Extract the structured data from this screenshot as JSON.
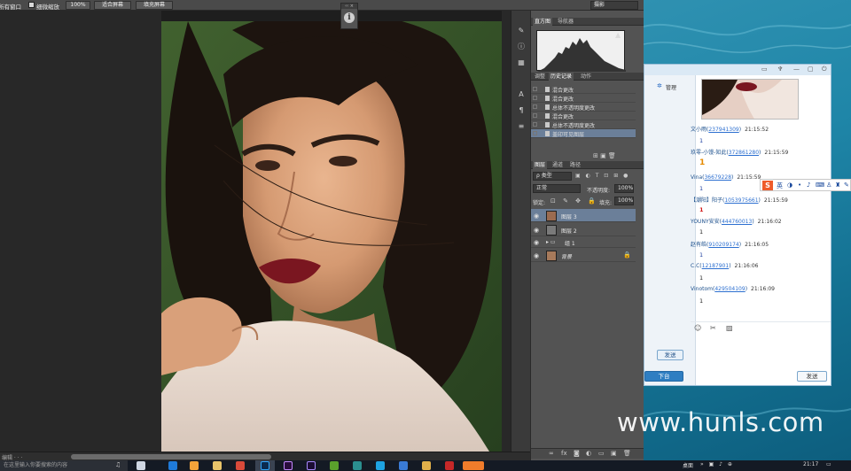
{
  "options_bar": {
    "all_windows_label": "所有窗口",
    "scrubby_zoom_label": "细微缩放",
    "zoom_100_label": "100%",
    "fit_screen_label": "适合屏幕",
    "fill_screen_label": "填充屏幕",
    "workspace_select": "摄影"
  },
  "status_bar": {
    "text": "编辑 · · ·"
  },
  "panels": {
    "top_tabs": [
      "直方图",
      "导航器"
    ],
    "history_tabs": [
      "调整",
      "历史记录",
      "动作"
    ],
    "history_items": [
      {
        "label": "混合更改",
        "selected": false
      },
      {
        "label": "混合更改",
        "selected": false
      },
      {
        "label": "总体不透明度更改",
        "selected": false
      },
      {
        "label": "混合更改",
        "selected": false
      },
      {
        "label": "总体不透明度更改",
        "selected": false
      },
      {
        "label": "盖印可见图层",
        "selected": true
      }
    ],
    "layers_tabs": [
      "图层",
      "通道",
      "路径"
    ],
    "kind_filter": "ρ 类型",
    "blend_mode": "正常",
    "opacity_label": "不透明度:",
    "opacity_value": "100%",
    "lock_label": "锁定:",
    "fill_label": "填充:",
    "fill_value": "100%",
    "layers": [
      {
        "name": "图层 3",
        "selected": true
      },
      {
        "name": "图层 2",
        "selected": false
      },
      {
        "name": "组 1",
        "selected": false
      },
      {
        "name": "背景",
        "selected": false
      }
    ]
  },
  "qq": {
    "manage_label": "管理",
    "messages": [
      {
        "nick": "文小雨",
        "qq": "237941309",
        "time": "21:15:52",
        "body": "1",
        "style": "normal"
      },
      {
        "nick": "玖零-小馒-知此",
        "qq": "372861280",
        "time": "21:15:59",
        "body": "1",
        "style": "big"
      },
      {
        "nick": "Vina",
        "qq": "36679228",
        "time": "21:15:59",
        "body": "1",
        "style": "normal"
      },
      {
        "nick": "【潮阳】阳子",
        "qq": "1053975661",
        "time": "21:15:59",
        "body": "1",
        "style": "red"
      },
      {
        "nick": "YOUNY安安",
        "qq": "444760013",
        "time": "21:16:02",
        "body": "1",
        "style": "dark"
      },
      {
        "nick": "赵有皓",
        "qq": "910209174",
        "time": "21:16:05",
        "body": "1",
        "style": "normal"
      },
      {
        "nick": "C.C",
        "qq": "12187901",
        "time": "21:16:06",
        "body": "1",
        "style": "dark"
      },
      {
        "nick": "Vinotom",
        "qq": "429504109",
        "time": "21:16:09",
        "body": "1",
        "style": "dark"
      }
    ],
    "left_send_label": "发送",
    "download_label": "下台",
    "send_label": "发送"
  },
  "ime": {
    "lang_label": "英"
  },
  "watermark": "www.hunls.com",
  "taskbar": {
    "search_text": "在这里输入你要搜索的内容",
    "tray_desktop": "桌面",
    "clock": "21:17"
  },
  "colors": {
    "ps_panel": "#535353",
    "selection": "#6b7f99",
    "qq_link": "#2c6fd0",
    "taskbar": "#141a24"
  }
}
